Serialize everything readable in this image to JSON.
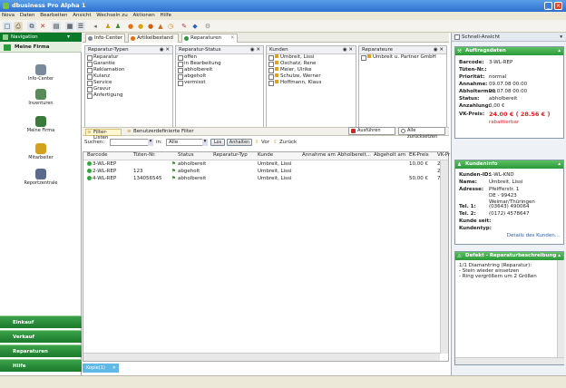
{
  "window": {
    "title": "dbusiness Pro Alpha 1"
  },
  "menu": [
    "Nova",
    "Daten",
    "Bearbeiten",
    "Ansicht",
    "Wechseln zu",
    "Aktionen",
    "Hilfe"
  ],
  "sidebar": {
    "header": "Navigation",
    "section_title": "Meine Firma",
    "items": [
      {
        "label": "Info-Center"
      },
      {
        "label": "Inventuren"
      },
      {
        "label": "Meine Firma"
      },
      {
        "label": "Mitarbeiter"
      },
      {
        "label": "Reportzentrale"
      }
    ],
    "bottom": [
      {
        "label": "Einkauf"
      },
      {
        "label": "Verkauf"
      },
      {
        "label": "Reparaturen"
      },
      {
        "label": "Hilfe"
      }
    ]
  },
  "tabs": [
    {
      "label": "Info-Center"
    },
    {
      "label": "Artikelbestand"
    },
    {
      "label": "Reparaturen"
    }
  ],
  "filters": {
    "typen": {
      "title": "Reparatur-Typen",
      "items": [
        "Reparatur",
        "Garantie",
        "Reklamation",
        "Kulanz",
        "Service",
        "Gravur",
        "Anfertigung"
      ]
    },
    "status": {
      "title": "Reparatur-Status",
      "items": [
        "offen",
        "in Bearbeitung",
        "abholbereit",
        "abgeholt",
        "vermisst"
      ]
    },
    "kunden": {
      "title": "Kunden",
      "items": [
        "Umbreit, Lissi",
        "Oschatz, Rene",
        "Meier, Ulrike",
        "Schulze, Werner",
        "Hoffmann, Klaus"
      ]
    },
    "reparateure": {
      "title": "Reparateure",
      "items": [
        "Umbreit u. Partner GmbH"
      ]
    }
  },
  "actions": {
    "ausfuehren": "Ausführen",
    "zuruecksetzen": "Alle zurücksetzen"
  },
  "filterbar": {
    "tab1": "Filter-Listen",
    "tab2": "Benutzerdefinierte Filter"
  },
  "search": {
    "label": "Suchen:",
    "in": "in:",
    "scope": "Alle",
    "los": "Los",
    "anhalten": "Anhalten",
    "vor": "Vor",
    "zurueck": "Zurück"
  },
  "table": {
    "columns": [
      "Barcode",
      "Tüten-Nr.",
      "Status",
      "Reparatur-Typ",
      "Kunde",
      "Annahme am",
      "Abholbereit...",
      "Abgeholt am",
      "EK-Preis",
      "VK-Pr"
    ],
    "rows": [
      {
        "barcode": "3-WL-REP",
        "tueten": "",
        "status": "abholbereit",
        "typ": "",
        "kunde": "Umbreit, Lissi",
        "annahme": "",
        "abholbereit": "",
        "abgeholt": "",
        "ek": "10,00 €",
        "vk": "24,0"
      },
      {
        "barcode": "2-WL-REP",
        "tueten": "123",
        "status": "abgeholt",
        "typ": "",
        "kunde": "Umbreit, Lissi",
        "annahme": "",
        "abholbereit": "",
        "abgeholt": "",
        "ek": "",
        "vk": "29,9"
      },
      {
        "barcode": "4-WL-REP",
        "tueten": "134056545",
        "status": "abholbereit",
        "typ": "",
        "kunde": "Umbreit, Lissi",
        "annahme": "",
        "abholbereit": "",
        "abgeholt": "",
        "ek": "50,00 €",
        "vk": "76,9"
      }
    ]
  },
  "bottom_tab": {
    "label": "Kopie(1)"
  },
  "quick": {
    "title": "Schnell-Ansicht",
    "auftrag": {
      "title": "Auftragsdaten",
      "rows": [
        {
          "k": "Barcode:",
          "v": "3-WL-REP"
        },
        {
          "k": "Tüten-Nr.:",
          "v": ""
        },
        {
          "k": "Priorität:",
          "v": "normal"
        },
        {
          "k": "Annahme:",
          "v": "09.07.08 00:00"
        },
        {
          "k": "Abholtermin:",
          "v": "23.07.08 00:00"
        },
        {
          "k": "Status:",
          "v": "abholbereit"
        },
        {
          "k": "Anzahlung:",
          "v": "0,00 €"
        }
      ],
      "vk_label": "VK-Preis:",
      "vk_value": "24.00 € ( 28.56 € )",
      "rabatt": "rabattierbar"
    },
    "kunde": {
      "title": "Kundeninfo",
      "rows": [
        {
          "k": "Kunden-ID:",
          "v": "1-WL-KND"
        },
        {
          "k": "Name:",
          "v": "Umbreit, Lissi"
        },
        {
          "k": "Adresse:",
          "v": "Pfeifferstr. 1"
        },
        {
          "k": "",
          "v": "DE - 99423 Weimar/Thüringen"
        },
        {
          "k": "Tel. 1:",
          "v": "(03643) 490064"
        },
        {
          "k": "Tel. 2:",
          "v": "(0172) 4578647"
        },
        {
          "k": "Kunde seit:",
          "v": ""
        },
        {
          "k": "Kundentyp:",
          "v": ""
        }
      ],
      "details": "Details des Kunden..."
    },
    "defekt": {
      "title": "Defekt - Reparaturbeschreibung",
      "lines": [
        "1/1  Diamantring (Reparatur):",
        "   - Stein wieder einsetzen",
        "- Ring vergrößern um 2 Größen"
      ]
    }
  },
  "colors": {
    "green": "#2a9a3a",
    "navgreen": "#0a7a2a",
    "titlebar": "#2d6fd0",
    "red": "#d22"
  }
}
